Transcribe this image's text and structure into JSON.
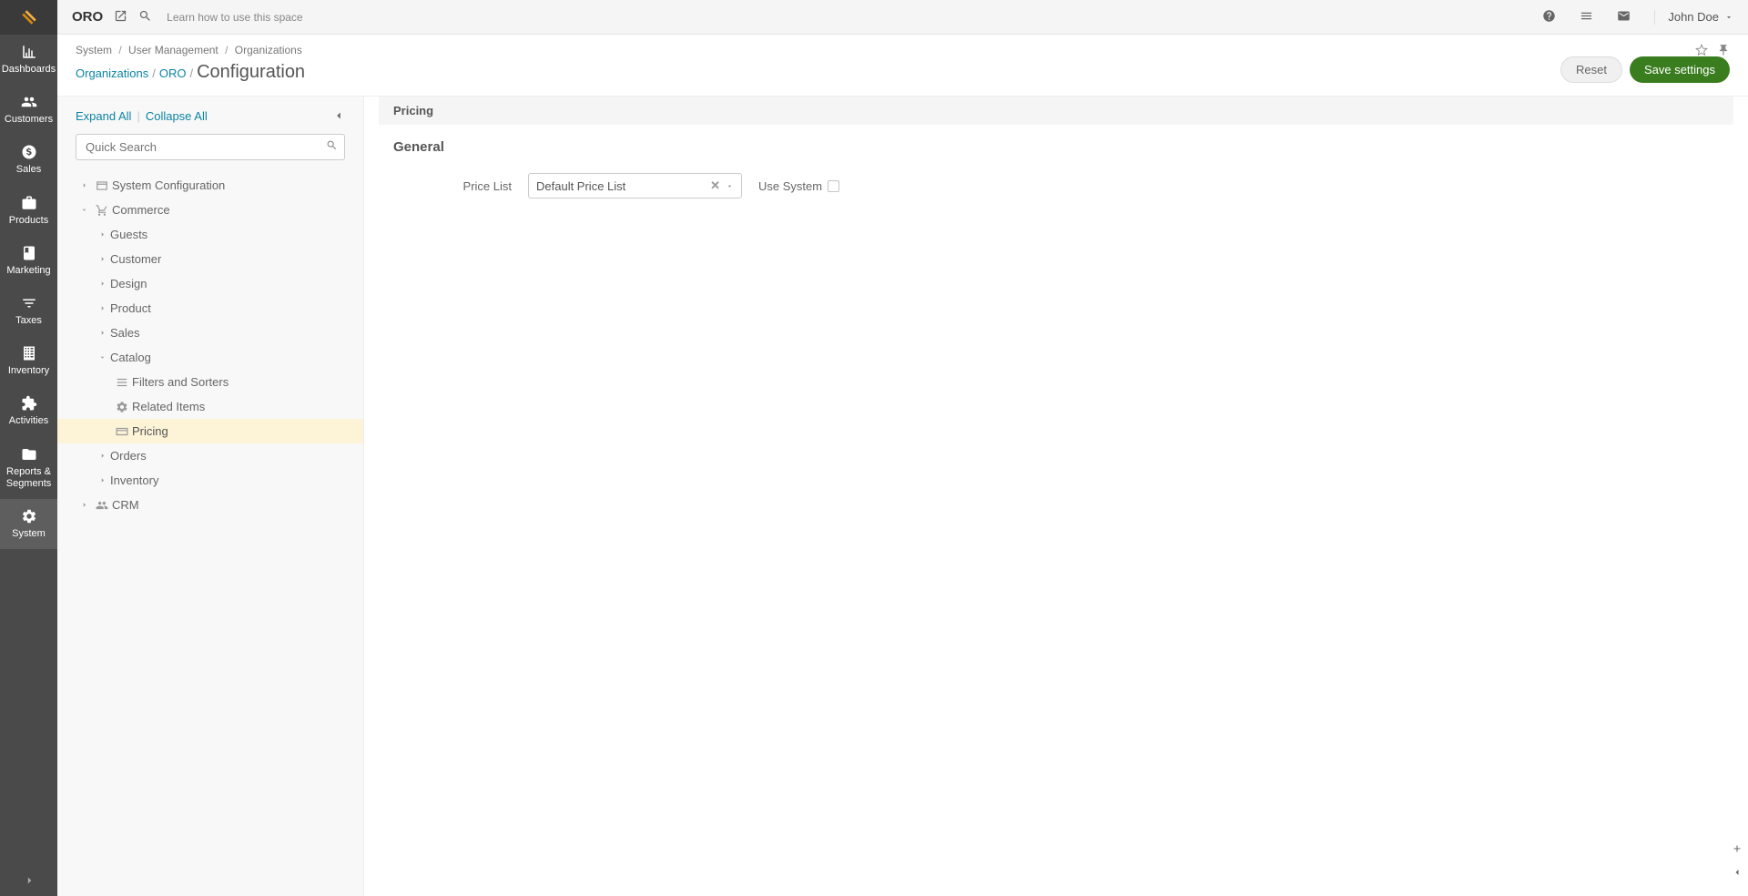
{
  "nav": {
    "items": [
      {
        "label": "Dashboards",
        "icon": "bar-chart"
      },
      {
        "label": "Customers",
        "icon": "users"
      },
      {
        "label": "Sales",
        "icon": "dollar"
      },
      {
        "label": "Products",
        "icon": "briefcase"
      },
      {
        "label": "Marketing",
        "icon": "book"
      },
      {
        "label": "Taxes",
        "icon": "filter"
      },
      {
        "label": "Inventory",
        "icon": "building"
      },
      {
        "label": "Activities",
        "icon": "puzzle"
      },
      {
        "label": "Reports & Segments",
        "icon": "folder-open"
      },
      {
        "label": "System",
        "icon": "gear"
      }
    ],
    "active_index": 9
  },
  "topbar": {
    "brand": "ORO",
    "help_text": "Learn how to use this space",
    "user_name": "John Doe"
  },
  "breadcrumbs_small": [
    "System",
    "User Management",
    "Organizations"
  ],
  "breadcrumbs_title": {
    "links": [
      "Organizations",
      "ORO"
    ],
    "current": "Configuration"
  },
  "buttons": {
    "reset": "Reset",
    "save": "Save settings"
  },
  "tree_panel": {
    "expand": "Expand All",
    "collapse": "Collapse All",
    "search_placeholder": "Quick Search",
    "nodes": {
      "sysconf": "System Configuration",
      "commerce": "Commerce",
      "guests": "Guests",
      "customer": "Customer",
      "design": "Design",
      "product": "Product",
      "sales": "Sales",
      "catalog": "Catalog",
      "filters": "Filters and Sorters",
      "related": "Related Items",
      "pricing": "Pricing",
      "orders": "Orders",
      "inventory": "Inventory",
      "crm": "CRM"
    }
  },
  "content": {
    "section_bar": "Pricing",
    "section_title": "General",
    "price_list_label": "Price List",
    "price_list_value": "Default Price List",
    "use_system_label": "Use System"
  }
}
